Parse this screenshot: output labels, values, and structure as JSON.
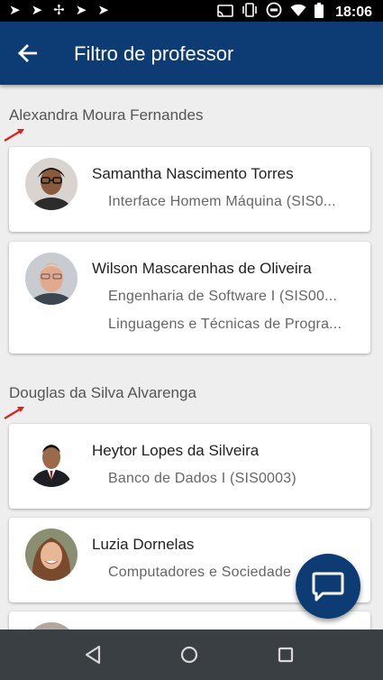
{
  "status_bar": {
    "time": "18:06",
    "left_icons": [
      "send-icon",
      "send-icon",
      "pinwheel-icon",
      "send-icon",
      "send-icon"
    ],
    "right_icons": [
      "cast-icon",
      "vibrate-icon",
      "do-not-disturb-icon",
      "wifi-icon",
      "battery-icon"
    ]
  },
  "app_bar": {
    "title": "Filtro de professor",
    "color": "#0d3b73"
  },
  "groups": [
    {
      "header": "Alexandra Moura Fernandes",
      "professors": [
        {
          "name": "Samantha Nascimento Torres",
          "subjects": [
            "Interface Homem Máquina (SIS0..."
          ]
        },
        {
          "name": "Wilson Mascarenhas de Oliveira",
          "subjects": [
            "Engenharia de Software I (SIS00...",
            "Linguagens e Técnicas de Progra..."
          ]
        }
      ]
    },
    {
      "header": "Douglas da Silva Alvarenga",
      "professors": [
        {
          "name": "Heytor Lopes da Silveira",
          "subjects": [
            "Banco de Dados I (SIS0003)"
          ]
        },
        {
          "name": "Luzia Dornelas",
          "subjects": [
            "Computadores e Sociedade"
          ]
        }
      ]
    }
  ],
  "fab": {
    "icon": "chat-icon"
  },
  "nav_bar": {
    "icons": [
      "back-triangle-icon",
      "home-circle-icon",
      "recents-square-icon"
    ]
  }
}
